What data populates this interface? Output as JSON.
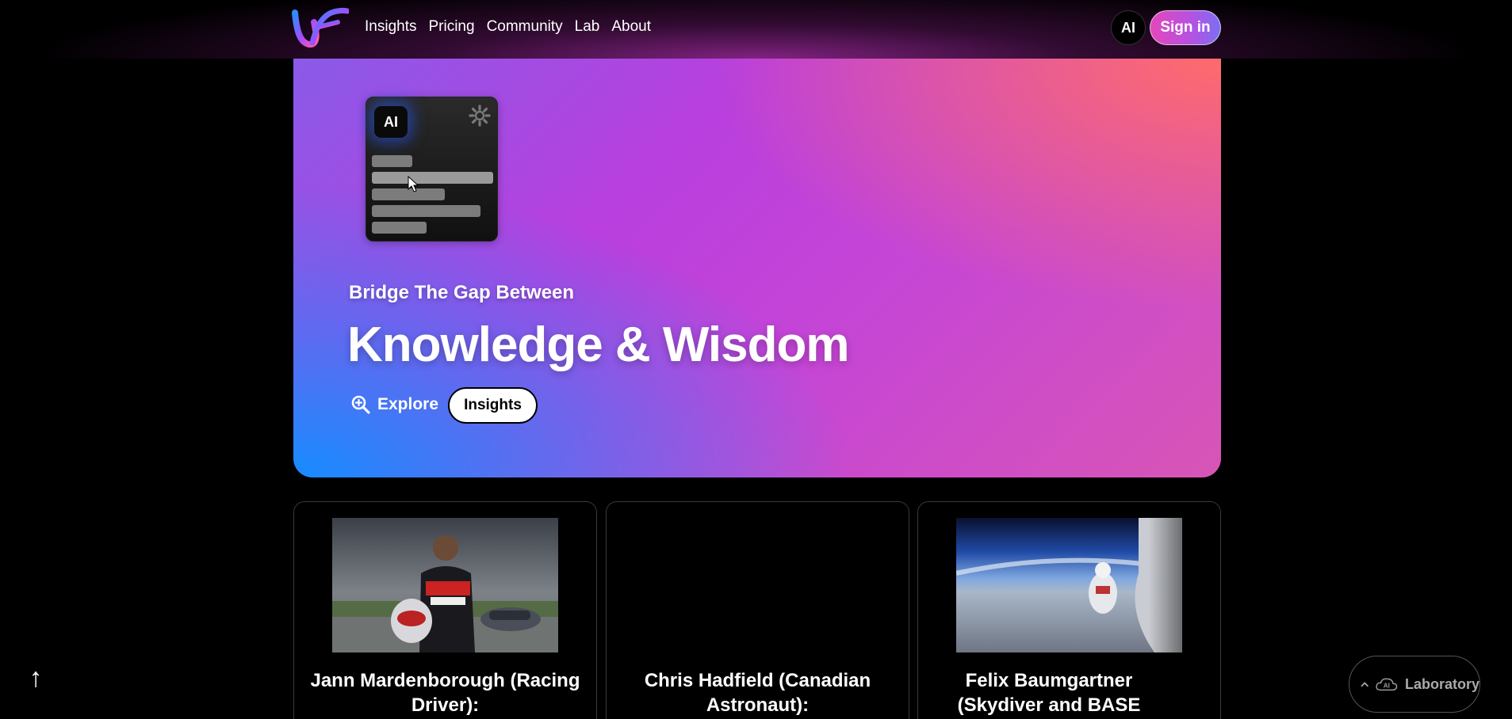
{
  "header": {
    "logo_name": "uf-logo",
    "nav": [
      {
        "label": "Insights"
      },
      {
        "label": "Pricing"
      },
      {
        "label": "Community"
      },
      {
        "label": "Lab"
      },
      {
        "label": "About"
      }
    ],
    "ai_badge": "AI",
    "signin_label": "Sign in"
  },
  "hero": {
    "mock_ai_label": "AI",
    "subtitle": "Bridge The Gap Between",
    "title": "Knowledge & Wisdom",
    "explore_label": "Explore",
    "insights_label": "Insights"
  },
  "cards": [
    {
      "title": "Jann Mardenborough (Racing Driver):"
    },
    {
      "title": "Chris Hadfield (Canadian Astronaut):"
    },
    {
      "title": "Felix Baumgartner (Skydiver and BASE jumper):"
    }
  ],
  "floating": {
    "lab_icon_label": "AI",
    "lab_label": "Laboratory"
  },
  "colors": {
    "signin_gradient_start": "#e447b9",
    "signin_gradient_end": "#7a6ff0",
    "hero_blue": "#168cff",
    "hero_purple": "#b93fde",
    "hero_coral": "#ff6b6b"
  }
}
